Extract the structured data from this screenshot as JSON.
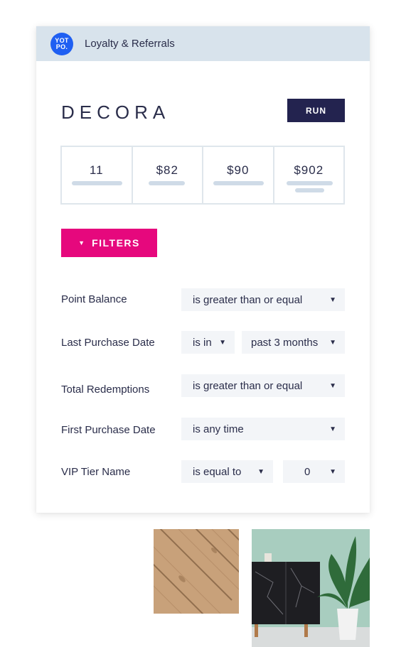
{
  "header": {
    "logo_line1": "YOT",
    "logo_line2": "PO.",
    "title": "Loyalty & Referrals"
  },
  "brand": "DECORA",
  "run_label": "RUN",
  "stats": [
    "11",
    "$82",
    "$90",
    "$902"
  ],
  "filters_label": "FILTERS",
  "filters": [
    {
      "label": "Point Balance",
      "values": [
        "is greater than or equal"
      ]
    },
    {
      "label": "Last Purchase Date",
      "values": [
        "is in",
        "past 3 months"
      ]
    },
    {
      "label": "Total Redemptions",
      "values": [
        "is greater than or equal"
      ]
    },
    {
      "label": "First Purchase Date",
      "values": [
        "is any time"
      ]
    },
    {
      "label": "VIP Tier Name",
      "values": [
        "is equal to",
        "0"
      ]
    }
  ],
  "colors": {
    "header_bg": "#d8e3ec",
    "logo_blue": "#1f5ff2",
    "run_bg": "#23234f",
    "filters_pink": "#e6087d",
    "dropdown_bg": "#f3f5f8"
  },
  "icons": {
    "dropdown_arrow": "caret-down-icon",
    "filters_caret": "caret-down-icon"
  }
}
